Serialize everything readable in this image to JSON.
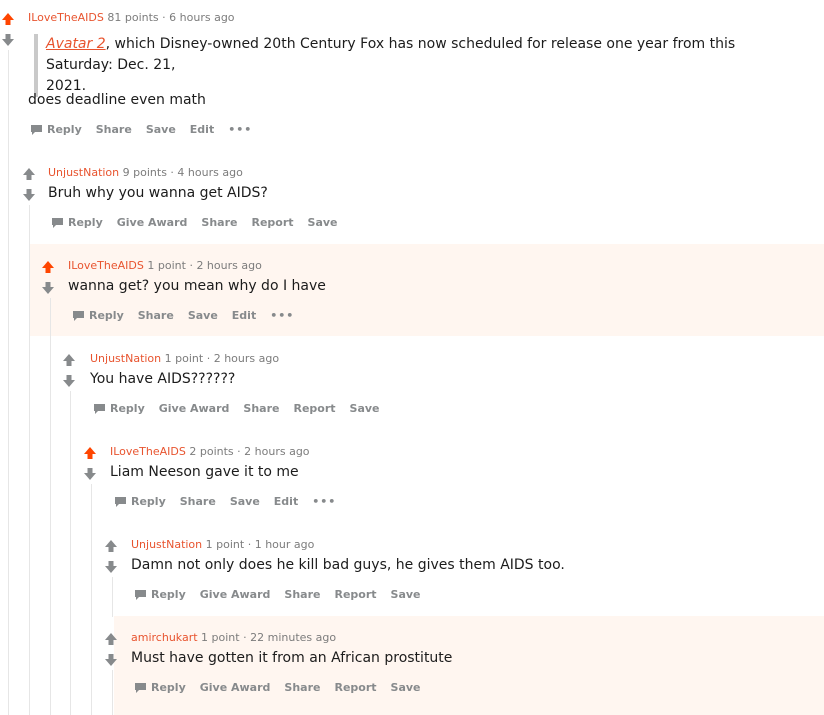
{
  "colors": {
    "accent": "#e8542f",
    "meta": "#7c7c7c",
    "action": "#878a8c",
    "highlight": "#fff6f0",
    "thread": "#e6e6e6",
    "upvoted": "#ff4500"
  },
  "comments": [
    {
      "author": "ILoveTheAIDS",
      "points": "81 points",
      "sep": "·",
      "time": "6 hours ago",
      "quote_link": "Avatar 2",
      "quote_line1": ", which Disney-owned 20th Century Fox has now scheduled for release one year from this Saturday: Dec. 21,",
      "quote_line2": "2021.",
      "body": "does deadline even math",
      "actions": [
        "Reply",
        "Share",
        "Save",
        "Edit",
        "•••"
      ]
    },
    {
      "author": "UnjustNation",
      "points": "9 points",
      "sep": "·",
      "time": "4 hours ago",
      "body": "Bruh why you wanna get AIDS?",
      "actions": [
        "Reply",
        "Give Award",
        "Share",
        "Report",
        "Save"
      ]
    },
    {
      "author": "ILoveTheAIDS",
      "points": "1 point",
      "sep": "·",
      "time": "2 hours ago",
      "body": "wanna get? you mean why do I have",
      "actions": [
        "Reply",
        "Share",
        "Save",
        "Edit",
        "•••"
      ]
    },
    {
      "author": "UnjustNation",
      "points": "1 point",
      "sep": "·",
      "time": "2 hours ago",
      "body": "You have AIDS??????",
      "actions": [
        "Reply",
        "Give Award",
        "Share",
        "Report",
        "Save"
      ]
    },
    {
      "author": "ILoveTheAIDS",
      "points": "2 points",
      "sep": "·",
      "time": "2 hours ago",
      "body": "Liam Neeson gave it to me",
      "actions": [
        "Reply",
        "Share",
        "Save",
        "Edit",
        "•••"
      ]
    },
    {
      "author": "UnjustNation",
      "points": "1 point",
      "sep": "·",
      "time": "1 hour ago",
      "body": "Damn not only does he kill bad guys, he gives them AIDS too.",
      "actions": [
        "Reply",
        "Give Award",
        "Share",
        "Report",
        "Save"
      ]
    },
    {
      "author": "amirchukart",
      "points": "1 point",
      "sep": "·",
      "time": "22 minutes ago",
      "body": "Must have gotten it from an African prostitute",
      "actions": [
        "Reply",
        "Give Award",
        "Share",
        "Report",
        "Save"
      ]
    }
  ]
}
